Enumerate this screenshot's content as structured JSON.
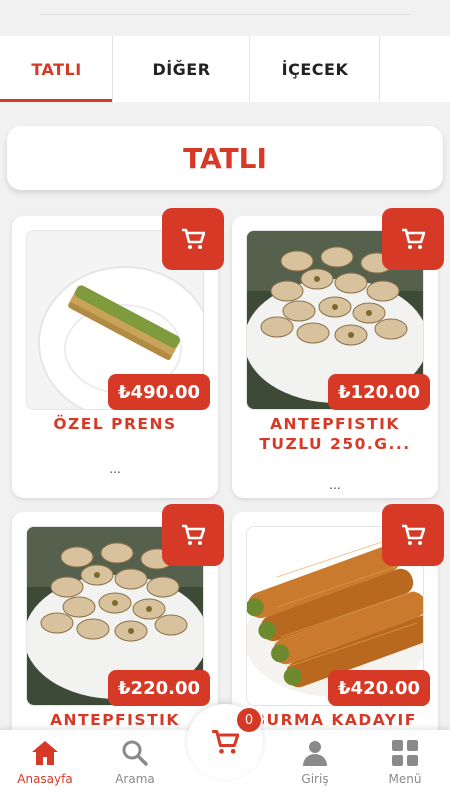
{
  "tabs": [
    {
      "label": "TATLI",
      "active": true
    },
    {
      "label": "DİĞER",
      "active": false
    },
    {
      "label": "İÇECEK",
      "active": false
    }
  ],
  "section": {
    "title": "TATLI"
  },
  "products": [
    {
      "name": "ÖZEL PRENS",
      "price": "₺490.00",
      "description": "...",
      "image": "baklava-roll-on-plate"
    },
    {
      "name": "ANTEPFISTIK TUZLU 250.G...",
      "price": "₺120.00",
      "description": "...",
      "image": "pistachios-bowl"
    },
    {
      "name": "ANTEPFISTIK",
      "price": "₺220.00",
      "description": "",
      "image": "pistachios-bowl"
    },
    {
      "name": "BURMA KADAYIF",
      "price": "₺420.00",
      "description": "",
      "image": "burma-kadayif-rolls"
    }
  ],
  "bottom_nav": {
    "home": {
      "label": "Anasayfa",
      "icon": "home-icon"
    },
    "search": {
      "label": "Arama",
      "icon": "search-icon"
    },
    "cart": {
      "count": "0",
      "icon": "cart-icon"
    },
    "login": {
      "label": "Giriş",
      "icon": "user-icon"
    },
    "menu": {
      "label": "Menü",
      "icon": "grid-icon"
    }
  },
  "colors": {
    "accent": "#d63a26",
    "background": "#f1f1f1",
    "inactive": "#8a8a8a"
  }
}
